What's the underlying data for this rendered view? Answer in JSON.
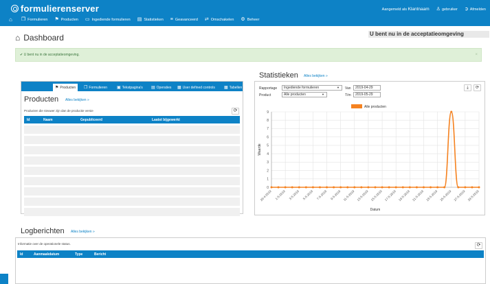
{
  "app": {
    "brand": "formulierenserver",
    "logged_in_label": "Aangemeld als",
    "client_name": "Klantnaam",
    "user": "gebruiker",
    "logout": "Afmelden"
  },
  "nav": [
    {
      "label": "Formulieren",
      "icon": "forms-icon"
    },
    {
      "label": "Producten",
      "icon": "tag-icon"
    },
    {
      "label": "Ingediende formulieren",
      "icon": "inbox-icon"
    },
    {
      "label": "Statistieken",
      "icon": "chart-icon"
    },
    {
      "label": "Geavanceerd",
      "icon": "sliders-icon"
    },
    {
      "label": "Omschakelen",
      "icon": "switch-icon"
    },
    {
      "label": "Beheer",
      "icon": "cogs-icon"
    }
  ],
  "page": {
    "title": "Dashboard",
    "env_banner": "U bent nu in de acceptatieomgeving",
    "alert": "U bent nu in de acceptatieomgeving."
  },
  "products": {
    "tabs": [
      {
        "label": "Producten",
        "icon": "tag-icon"
      },
      {
        "label": "Formulieren",
        "icon": "forms-icon"
      },
      {
        "label": "Tekstpagina's",
        "icon": "file-icon"
      },
      {
        "label": "Operaties",
        "icon": "list-icon"
      },
      {
        "label": "User defined controls",
        "icon": "grid-icon"
      },
      {
        "label": "Tabellen",
        "icon": "table-icon"
      }
    ],
    "title": "Producten",
    "view_all": "Alles bekijken »",
    "description": "Producten die nieuwer zijn dan de productie versie",
    "columns": [
      "Id",
      "Naam",
      "Gepubliceerd",
      "Laatst bijgewerkt"
    ],
    "row_count": 9
  },
  "stats": {
    "title": "Statistieken",
    "view_all": "Alles bekijken »",
    "report_label": "Rapportage",
    "report_value": "Ingediende formulieren",
    "product_label": "Product",
    "product_value": "Alle producten",
    "from_label": "Van",
    "from_value": "2019-04-29",
    "to_label": "T/m",
    "to_value": "2019-05-29"
  },
  "chart_data": {
    "type": "line",
    "series": [
      {
        "name": "Alle producten",
        "color": "#f58220",
        "values": [
          0,
          0,
          0,
          0,
          0,
          0,
          0,
          0,
          0,
          0,
          0,
          0,
          0,
          0,
          0,
          0,
          0,
          0,
          0,
          0,
          0,
          0,
          0,
          0,
          0,
          0,
          9,
          0,
          0,
          0,
          0
        ]
      }
    ],
    "x": [
      "29-4-2019",
      "30-4-2019",
      "1-5-2019",
      "2-5-2019",
      "3-5-2019",
      "4-5-2019",
      "5-5-2019",
      "6-5-2019",
      "7-5-2019",
      "8-5-2019",
      "9-5-2019",
      "10-5-2019",
      "11-5-2019",
      "12-5-2019",
      "13-5-2019",
      "14-5-2019",
      "15-5-2019",
      "16-5-2019",
      "17-5-2019",
      "18-5-2019",
      "19-5-2019",
      "20-5-2019",
      "21-5-2019",
      "22-5-2019",
      "23-5-2019",
      "24-5-2019",
      "25-5-2019",
      "26-5-2019",
      "27-5-2019",
      "28-5-2019",
      "29-5-2019"
    ],
    "x_ticks": [
      "29-4-2019",
      "1-5-2019",
      "3-5-2019",
      "5-5-2019",
      "7-5-2019",
      "9-5-2019",
      "11-5-2019",
      "13-5-2019",
      "15-5-2019",
      "17-5-2019",
      "19-5-2019",
      "21-5-2019",
      "23-5-2019",
      "25-5-2019",
      "27-5-2019",
      "29-5-2019"
    ],
    "y_ticks": [
      0,
      1,
      2,
      3,
      4,
      5,
      6,
      7,
      8,
      9
    ],
    "ylim": [
      0,
      9
    ],
    "xlabel": "Datum",
    "ylabel": "Waarde",
    "grid": true,
    "legend": "top-center"
  },
  "logs": {
    "title": "Logberichten",
    "view_all": "Alles bekijken »",
    "description": "Informatie over de operationele status.",
    "columns": [
      "Id",
      "Aanmaakdatum",
      "Type",
      "Bericht"
    ]
  }
}
